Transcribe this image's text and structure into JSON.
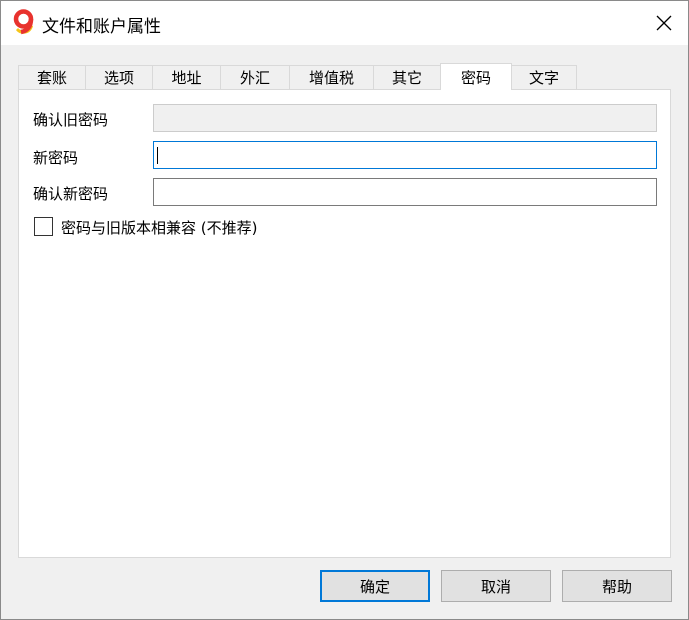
{
  "window": {
    "title": "文件和账户属性",
    "icon": "app-logo-9",
    "close_icon": "close-icon"
  },
  "tabs": [
    {
      "label": "套账",
      "active": false
    },
    {
      "label": "选项",
      "active": false
    },
    {
      "label": "地址",
      "active": false
    },
    {
      "label": "外汇",
      "active": false
    },
    {
      "label": "增值税",
      "active": false
    },
    {
      "label": "其它",
      "active": false
    },
    {
      "label": "密码",
      "active": true
    },
    {
      "label": "文字",
      "active": false
    }
  ],
  "form": {
    "old_password_label": "确认旧密码",
    "old_password_value": "",
    "new_password_label": "新密码",
    "new_password_value": "",
    "confirm_password_label": "确认新密码",
    "confirm_password_value": "",
    "compat_label": "密码与旧版本相兼容 (不推荐)",
    "compat_checked": false
  },
  "buttons": {
    "ok": "确定",
    "cancel": "取消",
    "help": "帮助"
  },
  "colors": {
    "accent": "#0078d7",
    "logo_red": "#e8322e",
    "logo_yellow": "#f5c518"
  }
}
